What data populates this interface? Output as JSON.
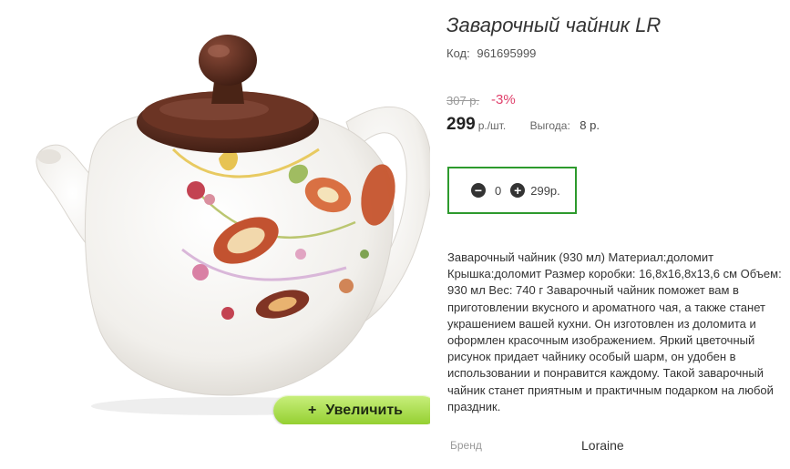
{
  "product": {
    "title": "Заварочный чайник LR",
    "code_label": "Код:",
    "code_value": "961695999",
    "old_price": "307 р.",
    "discount": "-3%",
    "price": "299",
    "price_unit": "р./шт.",
    "benefit_label": "Выгода:",
    "benefit_value": "8 р."
  },
  "cart": {
    "minus_icon": "minus-circle-icon",
    "plus_icon": "plus-circle-icon",
    "quantity": "0",
    "total": "299р."
  },
  "image": {
    "zoom_label": "Увеличить",
    "zoom_icon": "+"
  },
  "description": "Заварочный чайник (930 мл) Материал:доломит Крышка:доломит Размер коробки: 16,8x16,8x13,6 см Объем: 930 мл Вес: 740 г Заварочный чайник поможет вам в приготовлении вкусного и ароматного чая, а также станет украшением вашей кухни. Он изготовлен из доломита и оформлен красочным изображением. Яркий цветочный рисунок придает чайнику особый шарм, он удобен в использовании и понравится каждому. Такой заварочный чайник станет приятным и практичным подарком на любой праздник.",
  "brand": {
    "label": "Бренд",
    "value": "Loraine"
  },
  "colors": {
    "zoom_button": "#a8dc4a",
    "qty_border": "#2d9a2d",
    "discount": "#e0416c",
    "lid": "#4a2416"
  }
}
